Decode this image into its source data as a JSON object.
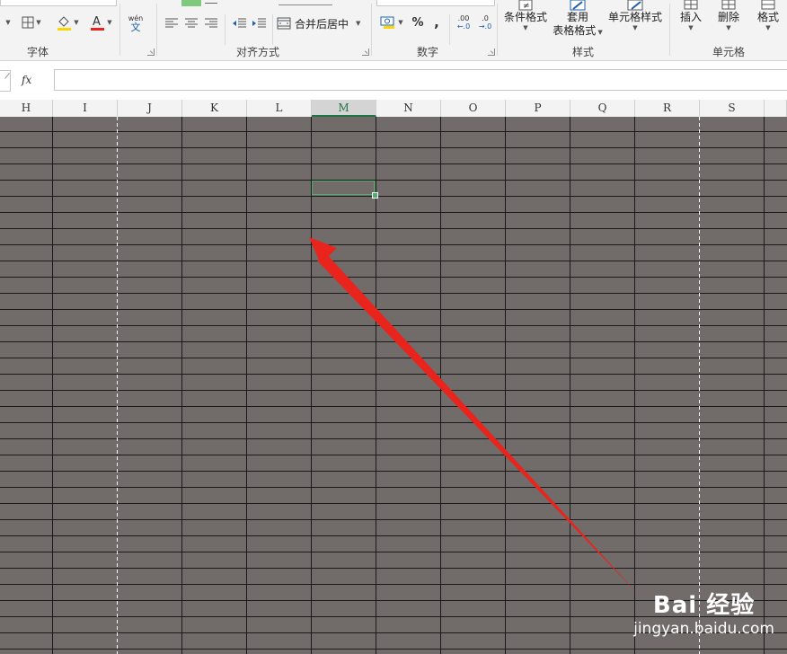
{
  "ribbon": {
    "groups": {
      "font": "字体",
      "align": "对齐方式",
      "number": "数字",
      "styles": "样式",
      "cells": "单元格"
    },
    "wen": "wén",
    "wen_sub": "文",
    "merge_label": "合并后居中",
    "percent": "%",
    "comma": ",",
    "dec_inc": ".00",
    "dec_dec": ".0",
    "cond_format": "条件格式",
    "table_format_1": "套用",
    "table_format_2": "表格格式",
    "cell_style": "单元格样式",
    "insert": "插入",
    "delete": "删除",
    "format": "格式",
    "colors": {
      "font_red": "#e8241c",
      "fill_yellow": "#ffd500",
      "green_accent": "#7fc97f"
    }
  },
  "formula_bar": {
    "fx": "fx",
    "value": ""
  },
  "columns": [
    "H",
    "I",
    "J",
    "K",
    "L",
    "M",
    "N",
    "O",
    "P",
    "Q",
    "R",
    "S"
  ],
  "selected_column": "M",
  "sheet": {
    "cell_fill": "#716b6a",
    "selection_color": "#4caf6a"
  },
  "watermark": {
    "logo": "Bai 经验",
    "url": "jingyan.baidu.com"
  }
}
